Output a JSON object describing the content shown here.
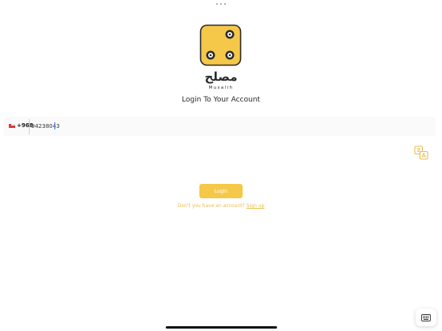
{
  "status_bar": {
    "multitask_dots_icon": "more-dots-icon"
  },
  "logo": {
    "icon": "dice-logo-icon",
    "arabic_text": "مصلح",
    "latin_text": "Musalih",
    "brand_yellow": "#f5c84a",
    "brand_dark": "#2b2b2b"
  },
  "login": {
    "heading": "Login To Your Account",
    "country_flag_icon": "oman-flag-icon",
    "country_code": "+968",
    "phone_value": "94238043",
    "phone_placeholder": "",
    "translate_icon": "translate-icon",
    "login_button_label": "Login",
    "no_account_text": "Don't you have an account?",
    "signup_link_text": "Sign up",
    "accent_color": "#f5c84a"
  },
  "system": {
    "keyboard_icon": "keyboard-icon"
  }
}
